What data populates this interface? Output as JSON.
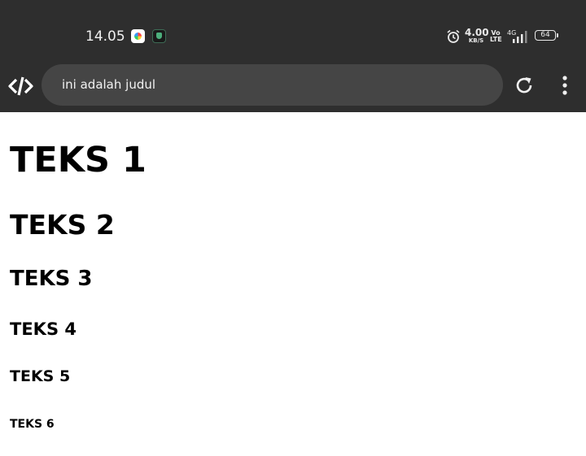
{
  "status_bar": {
    "time": "14.05",
    "notification_icons": [
      "photos-icon",
      "shield-icon"
    ],
    "system_icons": [
      "alarm-icon",
      "network-speed",
      "volte-icon",
      "signal-4g-icon",
      "battery-icon"
    ],
    "net_speed_value": "4.00",
    "net_speed_unit": "KB/S",
    "volte_top": "Vo",
    "volte_bottom": "LTE",
    "network_type": "4G",
    "battery_level": "64"
  },
  "toolbar": {
    "app_icon": "code-logo-icon",
    "url_text": "ini adalah judul",
    "reload_icon": "reload-icon",
    "menu_icon": "more-vert-icon"
  },
  "page": {
    "headings": [
      "TEKS 1",
      "TEKS 2",
      "TEKS 3",
      "TEKS 4",
      "TEKS 5",
      "TEKS 6"
    ]
  },
  "colors": {
    "bar_background": "#2e2e2e",
    "urlbar_background": "#454545",
    "page_background": "#ffffff",
    "text": "#000000"
  }
}
